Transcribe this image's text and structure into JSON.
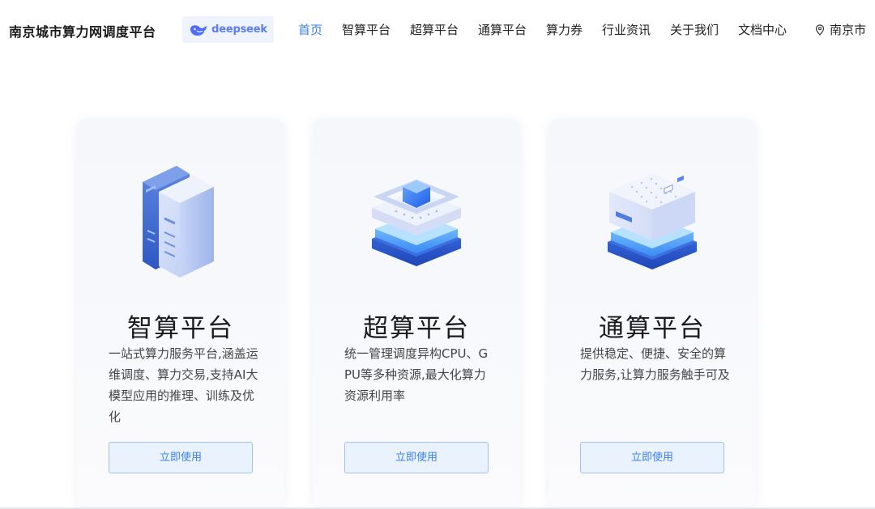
{
  "header": {
    "site_title": "南京城市算力网调度平台",
    "brand_text": "deepseek",
    "brand_icon": "whale-logo-icon",
    "location": "南京市",
    "location_icon": "map-pin-icon"
  },
  "nav": {
    "items": [
      {
        "label": "首页",
        "active": true
      },
      {
        "label": "智算平台",
        "active": false
      },
      {
        "label": "超算平台",
        "active": false
      },
      {
        "label": "通算平台",
        "active": false
      },
      {
        "label": "算力券",
        "active": false
      },
      {
        "label": "行业资讯",
        "active": false
      },
      {
        "label": "关于我们",
        "active": false
      },
      {
        "label": "文档中心",
        "active": false
      }
    ]
  },
  "cards": [
    {
      "title": "智算平台",
      "description": "一站式算力服务平台,涵盖运维调度、算力交易,支持AI大模型应用的推理、训练及优化",
      "button": "立即使用",
      "icon": "server-rack-icon"
    },
    {
      "title": "超算平台",
      "description": "统一管理调度异构CPU、GPU等多种资源,最大化算力资源利用率",
      "button": "立即使用",
      "icon": "supercompute-chip-icon"
    },
    {
      "title": "通算平台",
      "description": "提供稳定、便捷、安全的算力服务,让算力服务触手可及",
      "button": "立即使用",
      "icon": "general-compute-box-icon"
    }
  ],
  "colors": {
    "accent": "#3b82e8",
    "button_bg": "#e9f2fd",
    "button_border": "#9cc3f1"
  }
}
